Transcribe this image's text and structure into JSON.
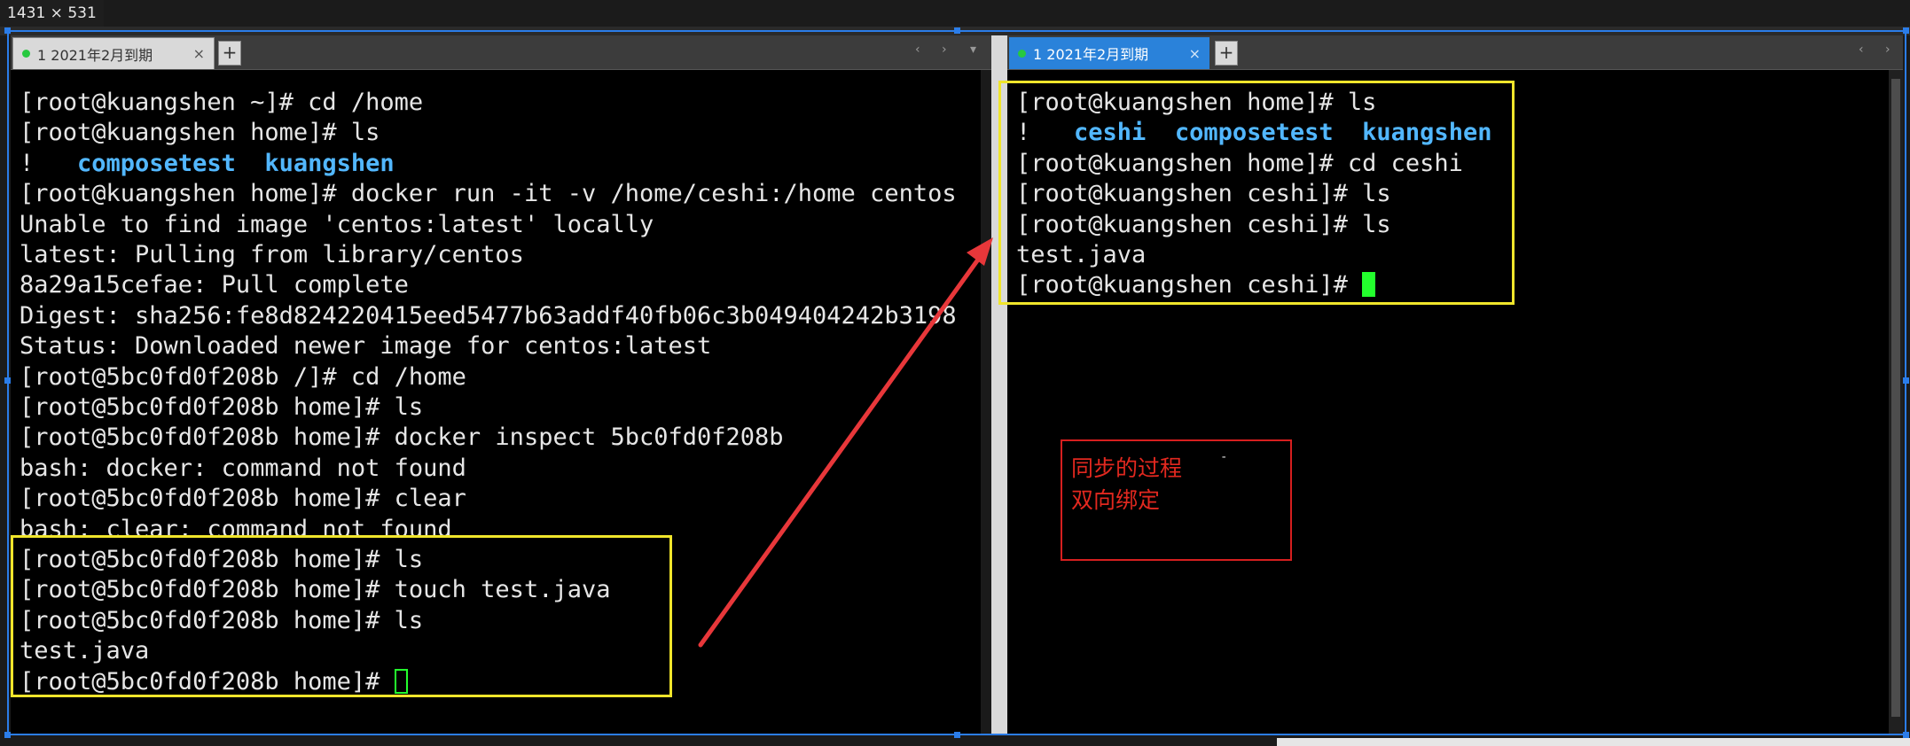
{
  "capture": {
    "size_label": "1431 × 531"
  },
  "left": {
    "tab": {
      "label": "1 2021年2月到期",
      "close": "×",
      "add": "+",
      "nav": "‹ ›"
    },
    "lines": [
      {
        "segments": [
          {
            "text": "[root@kuangshen ~]# cd /home"
          }
        ]
      },
      {
        "segments": [
          {
            "text": "[root@kuangshen home]# ls"
          }
        ]
      },
      {
        "segments": [
          {
            "text": "!   "
          },
          {
            "text": "composetest",
            "hl": true
          },
          {
            "text": "  "
          },
          {
            "text": "kuangshen",
            "hl": true
          }
        ]
      },
      {
        "segments": [
          {
            "text": "[root@kuangshen home]# docker run -it -v /home/ceshi:/home centos"
          }
        ]
      },
      {
        "segments": [
          {
            "text": "Unable to find image 'centos:latest' locally"
          }
        ]
      },
      {
        "segments": [
          {
            "text": "latest: Pulling from library/centos"
          }
        ]
      },
      {
        "segments": [
          {
            "text": "8a29a15cefae: Pull complete"
          }
        ]
      },
      {
        "segments": [
          {
            "text": "Digest: sha256:fe8d824220415eed5477b63addf40fb06c3b049404242b3198"
          }
        ]
      },
      {
        "segments": [
          {
            "text": "Status: Downloaded newer image for centos:latest"
          }
        ]
      },
      {
        "segments": [
          {
            "text": "[root@5bc0fd0f208b /]# cd /home"
          }
        ]
      },
      {
        "segments": [
          {
            "text": "[root@5bc0fd0f208b home]# ls"
          }
        ]
      },
      {
        "segments": [
          {
            "text": "[root@5bc0fd0f208b home]# docker inspect 5bc0fd0f208b"
          }
        ]
      },
      {
        "segments": [
          {
            "text": "bash: docker: command not found"
          }
        ]
      },
      {
        "segments": [
          {
            "text": "[root@5bc0fd0f208b home]# clear"
          }
        ]
      },
      {
        "segments": [
          {
            "text": "bash: clear: command not found"
          }
        ]
      },
      {
        "segments": [
          {
            "text": "[root@5bc0fd0f208b home]# ls"
          }
        ]
      },
      {
        "segments": [
          {
            "text": "[root@5bc0fd0f208b home]# touch test.java"
          }
        ]
      },
      {
        "segments": [
          {
            "text": "[root@5bc0fd0f208b home]# ls"
          }
        ]
      },
      {
        "segments": [
          {
            "text": "test.java"
          }
        ]
      },
      {
        "segments": [
          {
            "text": "[root@5bc0fd0f208b home]# "
          }
        ],
        "cursor": "hollow"
      }
    ]
  },
  "right": {
    "tab": {
      "label": "1 2021年2月到期",
      "close": "×",
      "add": "+",
      "nav": "‹ ›"
    },
    "lines": [
      {
        "segments": [
          {
            "text": "[root@kuangshen home]# ls"
          }
        ]
      },
      {
        "segments": [
          {
            "text": "!   "
          },
          {
            "text": "ceshi",
            "hl": true
          },
          {
            "text": "  "
          },
          {
            "text": "composetest",
            "hl": true
          },
          {
            "text": "  "
          },
          {
            "text": "kuangshen",
            "hl": true
          }
        ]
      },
      {
        "segments": [
          {
            "text": "[root@kuangshen home]# cd ceshi"
          }
        ]
      },
      {
        "segments": [
          {
            "text": "[root@kuangshen ceshi]# ls"
          }
        ]
      },
      {
        "segments": [
          {
            "text": "[root@kuangshen ceshi]# ls"
          }
        ]
      },
      {
        "segments": [
          {
            "text": "test.java"
          }
        ]
      },
      {
        "segments": [
          {
            "text": "[root@kuangshen ceshi]# "
          }
        ],
        "cursor": "solid"
      }
    ]
  },
  "annotation": {
    "line1": "同步的过程",
    "line2": "双向绑定",
    "dot": "-",
    "box_color": "#d61f1f",
    "arrow_color": "#e8373a"
  },
  "colors": {
    "highlight_box": "#f0e52b",
    "terminal_bg": "#000000",
    "dir_color": "#52b7ff",
    "cursor": "#23ff2d",
    "active_tab": "#2a82da"
  }
}
